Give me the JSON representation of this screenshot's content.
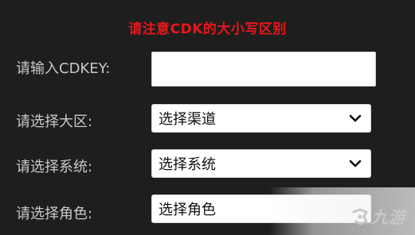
{
  "notice": "请注意CDK的大小写区别",
  "cdkey": {
    "label": "请输入CDKEY:",
    "value": "",
    "placeholder": ""
  },
  "region": {
    "label": "请选择大区:",
    "selected": "选择渠道"
  },
  "system": {
    "label": "请选择系统:",
    "selected": "选择系统"
  },
  "role": {
    "label": "请选择角色:",
    "selected": "选择角色"
  },
  "watermark": {
    "text": "九游",
    "icon": "jiuyou-logo-icon"
  },
  "colors": {
    "background": "#1e1e1e",
    "notice": "#e8161a",
    "label": "#c9c9c9"
  }
}
